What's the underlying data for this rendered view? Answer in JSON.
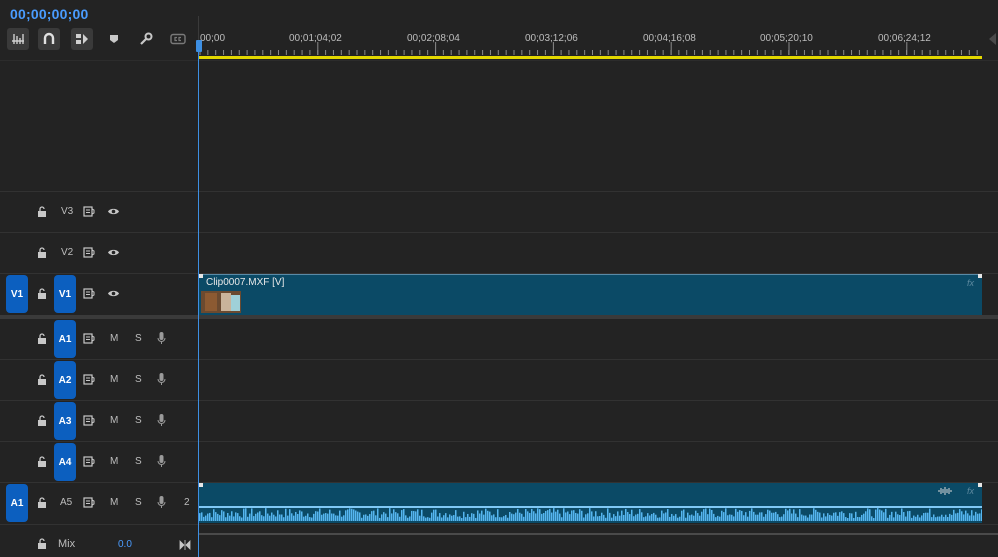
{
  "timecode": "00;00;00;00",
  "toolbar": {
    "buttons": [
      {
        "name": "nest-sequence-icon"
      },
      {
        "name": "snap-icon"
      },
      {
        "name": "linked-selection-icon"
      },
      {
        "name": "add-marker-icon"
      },
      {
        "name": "timeline-settings-icon"
      },
      {
        "name": "captions-icon"
      }
    ]
  },
  "ruler": {
    "ticks": [
      "00;00",
      "00;01;04;02",
      "00;02;08;04",
      "00;03;12;06",
      "00;04;16;08",
      "00;05;20;10",
      "00;06;24;12"
    ]
  },
  "tracks": {
    "video": [
      {
        "id": "V3",
        "source_target": "",
        "label": "V3"
      },
      {
        "id": "V2",
        "source_target": "",
        "label": "V2"
      },
      {
        "id": "V1",
        "source_target": "V1",
        "label": "V1"
      }
    ],
    "audio": [
      {
        "id": "A1",
        "label": "A1",
        "m": "M",
        "s": "S"
      },
      {
        "id": "A2",
        "label": "A2",
        "m": "M",
        "s": "S"
      },
      {
        "id": "A3",
        "label": "A3",
        "m": "M",
        "s": "S"
      },
      {
        "id": "A4",
        "label": "A4",
        "m": "M",
        "s": "S"
      },
      {
        "id": "A5",
        "source_target": "A1",
        "label": "A5",
        "m": "M",
        "s": "S",
        "channel": "2"
      }
    ],
    "mix": {
      "label": "Mix",
      "value": "0.0"
    }
  },
  "clips": {
    "video": {
      "name": "Clip0007.MXF [V]",
      "fx": "fx"
    },
    "audio": {
      "fx": "fx"
    }
  },
  "colors": {
    "accent": "#4a9cff",
    "track_target": "#0c5fbf",
    "clip": "#0b4a66",
    "work_area": "#e4d800",
    "waveform": "#56b6f0"
  }
}
